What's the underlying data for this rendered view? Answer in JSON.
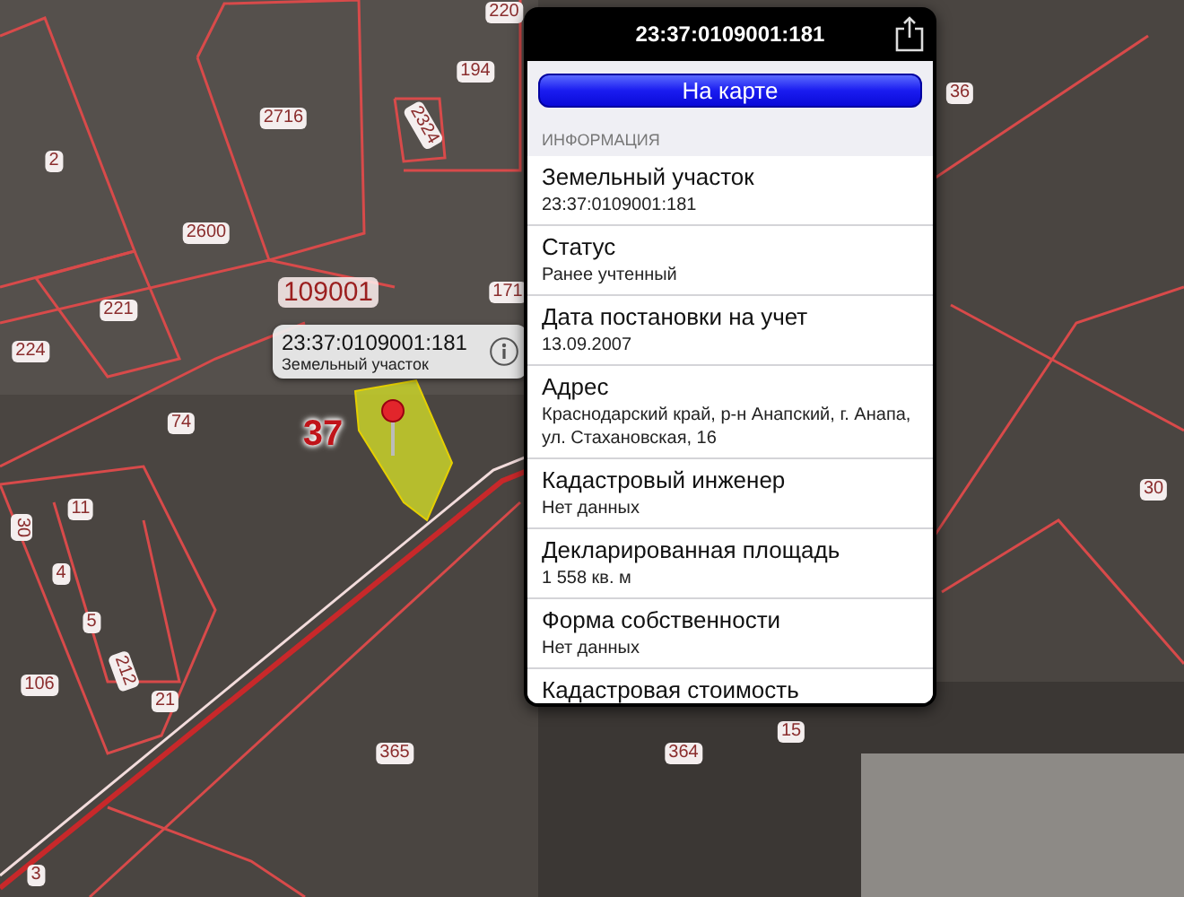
{
  "map": {
    "labels": [
      {
        "text": "220",
        "kind": "plain"
      },
      {
        "text": "194",
        "kind": "plain"
      },
      {
        "text": "2324",
        "kind": "plain"
      },
      {
        "text": "2716",
        "kind": "plain"
      },
      {
        "text": "2",
        "kind": "plain"
      },
      {
        "text": "2600",
        "kind": "plain"
      },
      {
        "text": "109001",
        "kind": "block"
      },
      {
        "text": "171",
        "kind": "plain"
      },
      {
        "text": "221",
        "kind": "plain"
      },
      {
        "text": "224",
        "kind": "plain"
      },
      {
        "text": "74",
        "kind": "plain"
      },
      {
        "text": "37",
        "kind": "quarter"
      },
      {
        "text": "36",
        "kind": "plain"
      },
      {
        "text": "30",
        "kind": "plain"
      },
      {
        "text": "11",
        "kind": "plain"
      },
      {
        "text": "30",
        "kind": "plain"
      },
      {
        "text": "4",
        "kind": "plain"
      },
      {
        "text": "5",
        "kind": "plain"
      },
      {
        "text": "212",
        "kind": "plain"
      },
      {
        "text": "21",
        "kind": "plain"
      },
      {
        "text": "106",
        "kind": "plain"
      },
      {
        "text": "365",
        "kind": "plain"
      },
      {
        "text": "3",
        "kind": "plain"
      },
      {
        "text": "364",
        "kind": "plain"
      },
      {
        "text": "15",
        "kind": "plain"
      }
    ],
    "callout": {
      "title": "23:37:0109001:181",
      "subtitle": "Земельный участок"
    }
  },
  "popover": {
    "title": "23:37:0109001:181",
    "button": "На карте",
    "section": "ИНФОРМАЦИЯ",
    "rows": [
      {
        "label": "Земельный участок",
        "value": "23:37:0109001:181"
      },
      {
        "label": "Статус",
        "value": "Ранее учтенный"
      },
      {
        "label": "Дата постановки на учет",
        "value": "13.09.2007"
      },
      {
        "label": "Адрес",
        "value": "Краснодарский край, р-н Анапский, г. Анапа, ул. Стахановская, 16"
      },
      {
        "label": "Кадастровый инженер",
        "value": "Нет данных"
      },
      {
        "label": "Декларированная площадь",
        "value": "1 558 кв. м"
      },
      {
        "label": "Форма собственности",
        "value": "Нет данных"
      },
      {
        "label": "Кадастровая стоимость"
      }
    ]
  }
}
